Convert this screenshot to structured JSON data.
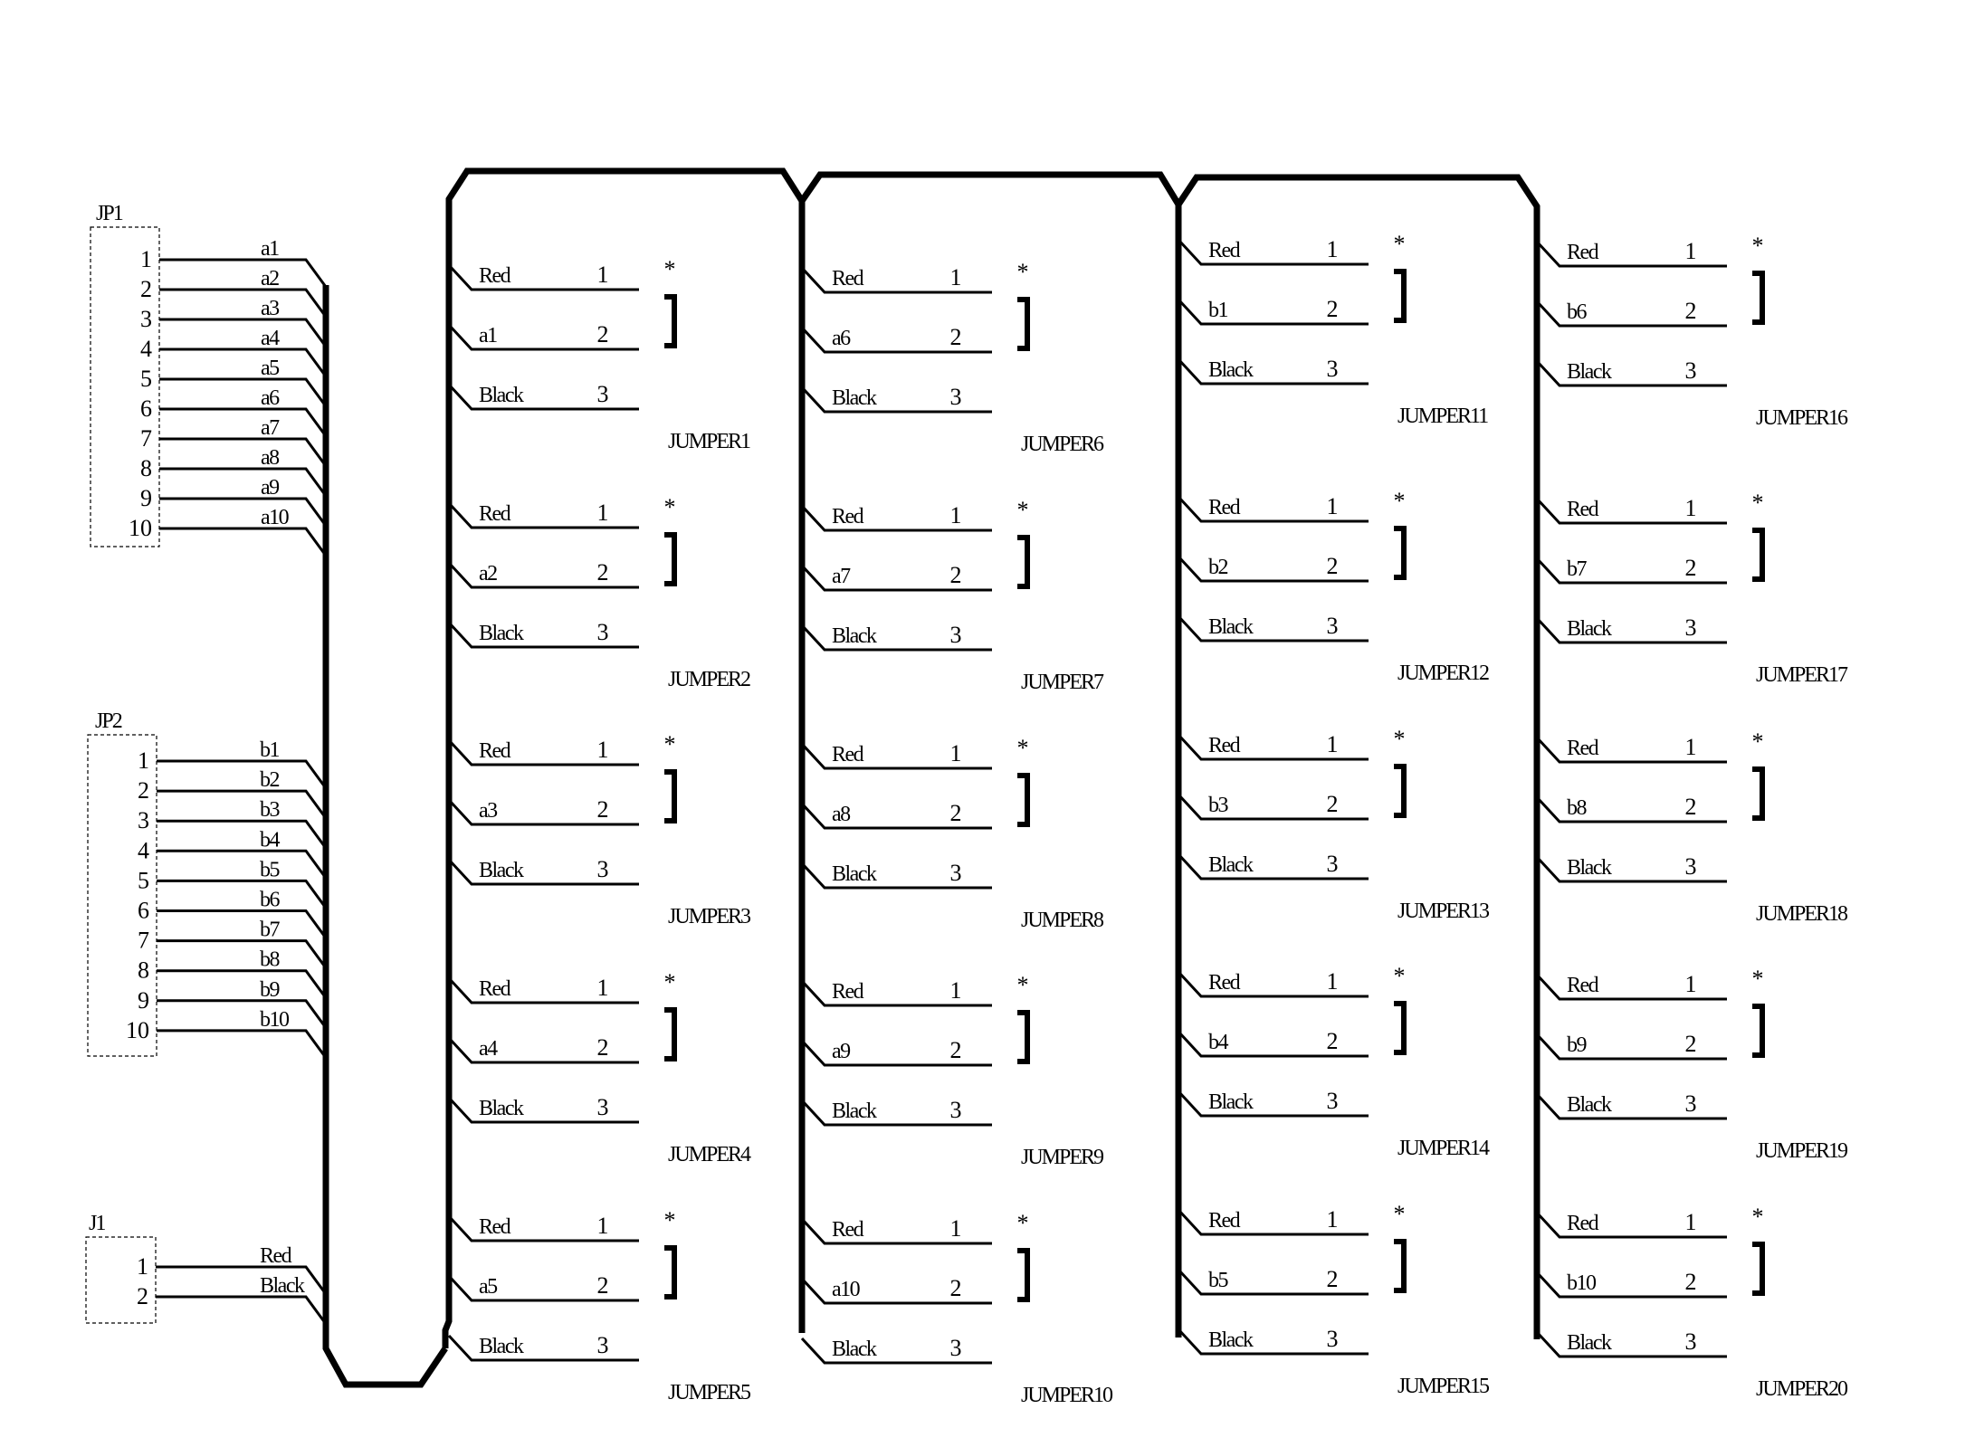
{
  "connectors": [
    {
      "ref": "JP1",
      "pins": [
        "1",
        "2",
        "3",
        "4",
        "5",
        "6",
        "7",
        "8",
        "9",
        "10"
      ],
      "nets": [
        "a1",
        "a2",
        "a3",
        "a4",
        "a5",
        "a6",
        "a7",
        "a8",
        "a9",
        "a10"
      ]
    },
    {
      "ref": "JP2",
      "pins": [
        "1",
        "2",
        "3",
        "4",
        "5",
        "6",
        "7",
        "8",
        "9",
        "10"
      ],
      "nets": [
        "b1",
        "b2",
        "b3",
        "b4",
        "b5",
        "b6",
        "b7",
        "b8",
        "b9",
        "b10"
      ]
    },
    {
      "ref": "J1",
      "pins": [
        "1",
        "2"
      ],
      "nets": [
        "Red",
        "Black"
      ]
    }
  ],
  "jumper_pin_numbers": [
    "1",
    "2",
    "3"
  ],
  "jumper_marker": "*",
  "jumpers": [
    {
      "ref": "JUMPER1",
      "nets": [
        "Red",
        "a1",
        "Black"
      ]
    },
    {
      "ref": "JUMPER2",
      "nets": [
        "Red",
        "a2",
        "Black"
      ]
    },
    {
      "ref": "JUMPER3",
      "nets": [
        "Red",
        "a3",
        "Black"
      ]
    },
    {
      "ref": "JUMPER4",
      "nets": [
        "Red",
        "a4",
        "Black"
      ]
    },
    {
      "ref": "JUMPER5",
      "nets": [
        "Red",
        "a5",
        "Black"
      ]
    },
    {
      "ref": "JUMPER6",
      "nets": [
        "Red",
        "a6",
        "Black"
      ]
    },
    {
      "ref": "JUMPER7",
      "nets": [
        "Red",
        "a7",
        "Black"
      ]
    },
    {
      "ref": "JUMPER8",
      "nets": [
        "Red",
        "a8",
        "Black"
      ]
    },
    {
      "ref": "JUMPER9",
      "nets": [
        "Red",
        "a9",
        "Black"
      ]
    },
    {
      "ref": "JUMPER10",
      "nets": [
        "Red",
        "a10",
        "Black"
      ]
    },
    {
      "ref": "JUMPER11",
      "nets": [
        "Red",
        "b1",
        "Black"
      ]
    },
    {
      "ref": "JUMPER12",
      "nets": [
        "Red",
        "b2",
        "Black"
      ]
    },
    {
      "ref": "JUMPER13",
      "nets": [
        "Red",
        "b3",
        "Black"
      ]
    },
    {
      "ref": "JUMPER14",
      "nets": [
        "Red",
        "b4",
        "Black"
      ]
    },
    {
      "ref": "JUMPER15",
      "nets": [
        "Red",
        "b5",
        "Black"
      ]
    },
    {
      "ref": "JUMPER16",
      "nets": [
        "Red",
        "b6",
        "Black"
      ]
    },
    {
      "ref": "JUMPER17",
      "nets": [
        "Red",
        "b7",
        "Black"
      ]
    },
    {
      "ref": "JUMPER18",
      "nets": [
        "Red",
        "b8",
        "Black"
      ]
    },
    {
      "ref": "JUMPER19",
      "nets": [
        "Red",
        "b9",
        "Black"
      ]
    },
    {
      "ref": "JUMPER20",
      "nets": [
        "Red",
        "b10",
        "Black"
      ]
    }
  ],
  "colors": {
    "ink": "#000000",
    "background": "#ffffff"
  }
}
